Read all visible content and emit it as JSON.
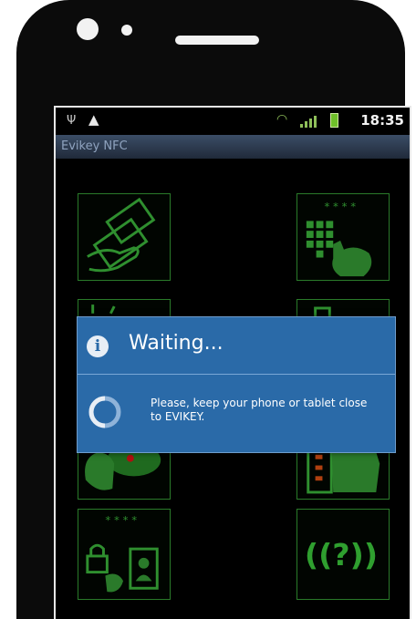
{
  "status_bar": {
    "time": "18:35"
  },
  "app": {
    "title": "Evikey NFC"
  },
  "dialog": {
    "title": "Waiting...",
    "message": "Please, keep your phone or tablet close to EVIKEY."
  },
  "colors": {
    "accent": "#2a6aa8",
    "tile_border": "#2a7a2a",
    "battery": "#6fbf2a"
  },
  "tiles": [
    {
      "icon": "card-tap-icon"
    },
    {
      "icon": "keypad-icon"
    },
    {
      "icon": "hand-key-icon"
    },
    {
      "icon": "device-hand-icon"
    },
    {
      "icon": "user-access-icon"
    },
    {
      "icon": "nfc-help-icon"
    }
  ]
}
